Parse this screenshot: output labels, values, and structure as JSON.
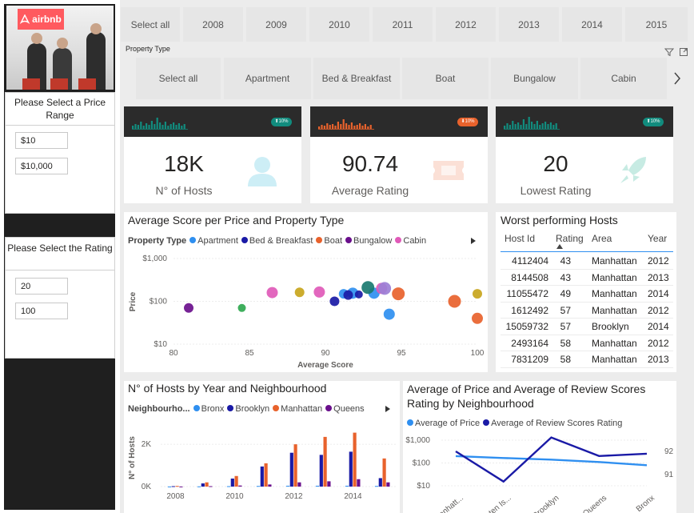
{
  "brand": {
    "logo_text": "airbnb",
    "accent": "#ff5a5f"
  },
  "filters": {
    "price": {
      "title": "Please Select a Price Range",
      "min": "$10",
      "max": "$10,000"
    },
    "rating": {
      "title": "Please Select the Rating",
      "min": "20",
      "max": "100"
    }
  },
  "years": {
    "items": [
      "Select all",
      "2008",
      "2009",
      "2010",
      "2011",
      "2012",
      "2013",
      "2014",
      "2015"
    ]
  },
  "property_type": {
    "label": "Property Type",
    "items": [
      "Select all",
      "Apartment",
      "Bed & Breakfast",
      "Boat",
      "Bungalow",
      "Cabin"
    ]
  },
  "kpis": [
    {
      "value": "18K",
      "label": "N° of Hosts",
      "badge": "10%",
      "color": "#118c7e"
    },
    {
      "value": "90.74",
      "label": "Average Rating",
      "badge": "10%",
      "color": "#e8622c"
    },
    {
      "value": "20",
      "label": "Lowest Rating",
      "badge": "10%",
      "color": "#118c7e"
    }
  ],
  "scatter": {
    "title": "Average Score per Price and Property Type",
    "legend_title": "Property Type",
    "xlabel": "Average Score",
    "ylabel": "Price",
    "yticks": [
      "$1,000",
      "$100",
      "$10"
    ],
    "xticks": [
      "80",
      "85",
      "90",
      "95",
      "100"
    ],
    "chart_data": {
      "type": "scatter",
      "xlim": [
        80,
        100
      ],
      "ylim": [
        10,
        1000
      ],
      "yscale": "log",
      "series": [
        {
          "name": "Apartment",
          "color": "#2f8ff0",
          "points": [
            [
              91.2,
              150
            ],
            [
              91.8,
              155
            ],
            [
              93.2,
              155
            ],
            [
              94.2,
              50
            ]
          ]
        },
        {
          "name": "Bed & Breakfast",
          "color": "#1a1aa6",
          "points": [
            [
              90.6,
              100
            ],
            [
              91.5,
              140
            ],
            [
              92.2,
              145
            ]
          ]
        },
        {
          "name": "Boat",
          "color": "#e8622c",
          "points": [
            [
              94.8,
              150
            ],
            [
              98.5,
              100
            ],
            [
              100,
              40
            ]
          ]
        },
        {
          "name": "Bungalow",
          "color": "#6a0f8c",
          "points": [
            [
              81,
              70
            ]
          ]
        },
        {
          "name": "Cabin",
          "color": "#e05ab8",
          "points": [
            [
              86.5,
              160
            ],
            [
              89.6,
              165
            ],
            [
              93.7,
              200
            ]
          ]
        },
        {
          "name": "",
          "color": "#c8a51c",
          "points": [
            [
              88.3,
              162
            ],
            [
              100,
              150
            ]
          ]
        },
        {
          "name": "",
          "color": "#2fa84f",
          "points": [
            [
              84.5,
              70
            ]
          ]
        },
        {
          "name": "",
          "color": "#1a7a70",
          "points": [
            [
              92.8,
              210
            ]
          ]
        },
        {
          "name": "",
          "color": "#9c7fd6",
          "points": [
            [
              93.9,
              200
            ]
          ]
        }
      ]
    }
  },
  "worst": {
    "title": "Worst performing Hosts",
    "columns": [
      "Host Id",
      "Rating",
      "Area",
      "Year"
    ],
    "rows": [
      [
        "4112404",
        "43",
        "Manhattan",
        "2012"
      ],
      [
        "8144508",
        "43",
        "Manhattan",
        "2013"
      ],
      [
        "11055472",
        "49",
        "Manhattan",
        "2014"
      ],
      [
        "1612492",
        "57",
        "Manhattan",
        "2012"
      ],
      [
        "15059732",
        "57",
        "Brooklyn",
        "2014"
      ],
      [
        "2493164",
        "58",
        "Manhattan",
        "2012"
      ],
      [
        "7831209",
        "58",
        "Manhattan",
        "2013"
      ]
    ]
  },
  "hosts_bar": {
    "title": "N° of Hosts by Year and Neighbourhood",
    "legend_title": "Neighbourho...",
    "ylabel": "N° of Hosts",
    "yticks": [
      "2K",
      "0K"
    ],
    "xticks": [
      "2008",
      "2010",
      "2012",
      "2014"
    ],
    "chart_data": {
      "type": "bar",
      "categories": [
        "2008",
        "2009",
        "2010",
        "2011",
        "2012",
        "2013",
        "2014",
        "2015"
      ],
      "ylim": [
        0,
        2800
      ],
      "series": [
        {
          "name": "Bronx",
          "color": "#2f8ff0",
          "values": [
            5,
            10,
            20,
            30,
            40,
            40,
            40,
            30
          ]
        },
        {
          "name": "Brooklyn",
          "color": "#1a1aa6",
          "values": [
            20,
            150,
            380,
            950,
            1600,
            1500,
            1650,
            400
          ]
        },
        {
          "name": "Manhattan",
          "color": "#e8622c",
          "values": [
            30,
            200,
            500,
            1100,
            2000,
            2350,
            2550,
            1330
          ]
        },
        {
          "name": "Queens",
          "color": "#6a0f8c",
          "values": [
            5,
            20,
            50,
            100,
            200,
            250,
            350,
            200
          ]
        }
      ]
    }
  },
  "line": {
    "title": "Average of Price and Average of Review Scores Rating by Neighbourhood",
    "yticks_left": [
      "$1,000",
      "$100",
      "$10"
    ],
    "yticks_right": [
      "92",
      "91"
    ],
    "xticks": [
      "Manhatt...",
      "Staten Is...",
      "Brooklyn",
      "Queens",
      "Bronx"
    ],
    "chart_data": {
      "type": "line",
      "categories": [
        "Manhattan",
        "Staten Island",
        "Brooklyn",
        "Queens",
        "Bronx"
      ],
      "series": [
        {
          "name": "Average of Price",
          "color": "#2f8ff0",
          "axis": "left",
          "values": [
            200,
            165,
            140,
            110,
            80
          ]
        },
        {
          "name": "Average of Review Scores Rating",
          "color": "#1a1aa6",
          "axis": "right",
          "values": [
            92.0,
            90.7,
            92.6,
            91.8,
            91.9
          ]
        }
      ]
    }
  }
}
